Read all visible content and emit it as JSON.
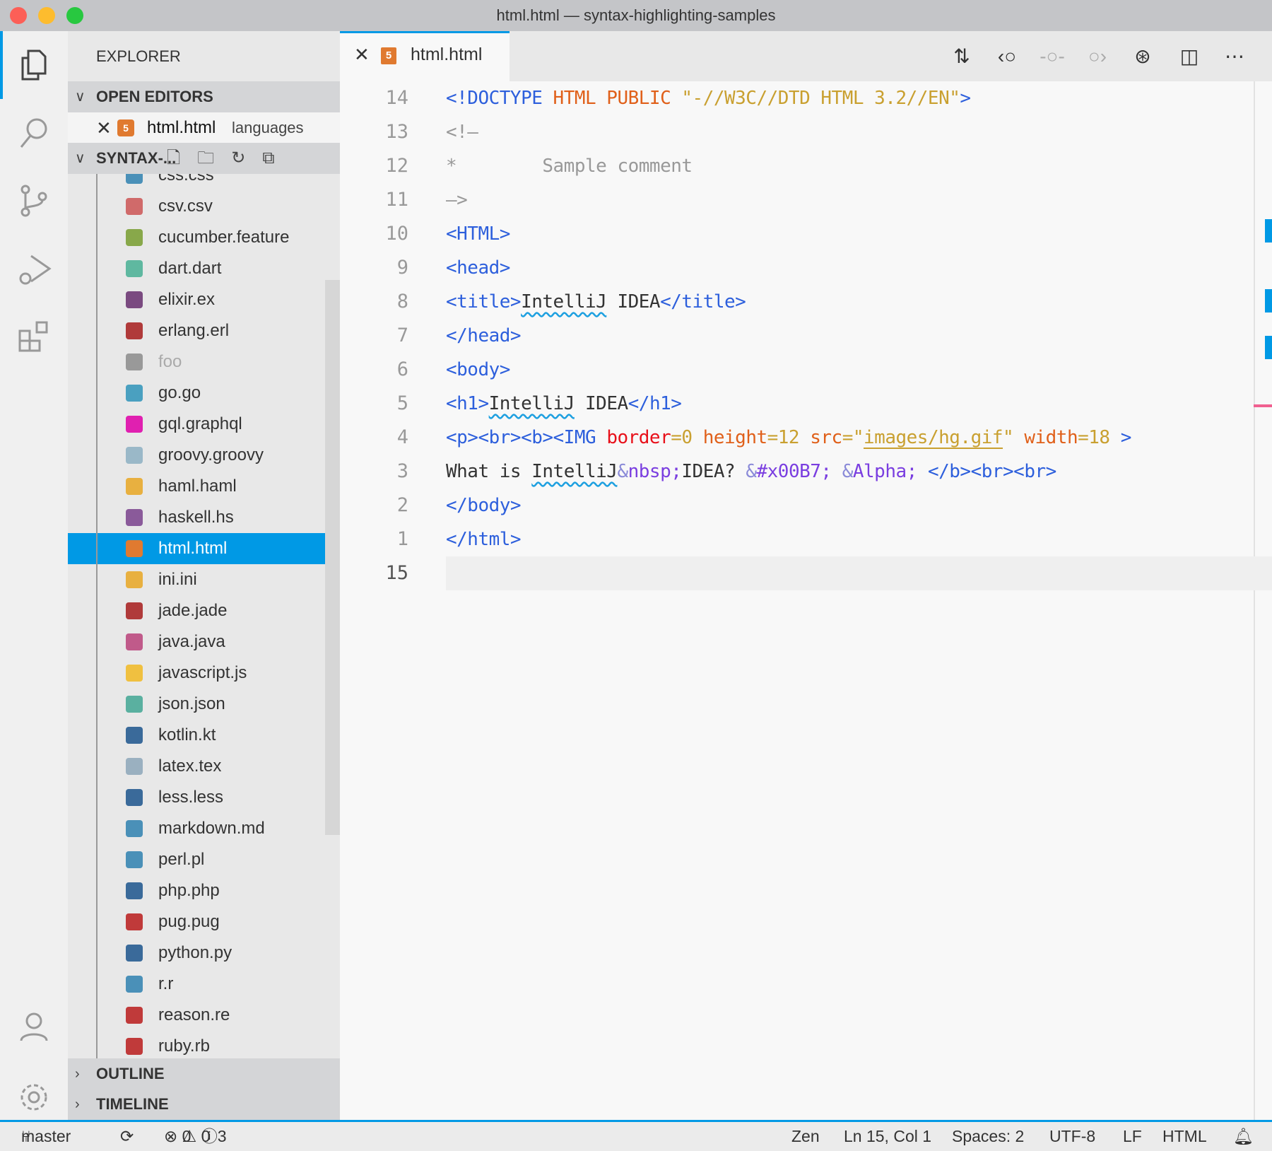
{
  "window": {
    "title": "html.html — syntax-highlighting-samples"
  },
  "colors": {
    "accent": "#0099e5",
    "tag": "#2d5fdc",
    "attr": "#e0601a",
    "attr_red": "#e8101a",
    "value": "#c9a030",
    "entity": "#7a3ee0",
    "entity_amp": "#8a8ad8",
    "text": "#333333",
    "comment": "#999999"
  },
  "activity": [
    "explorer-icon",
    "search-icon",
    "source-control-icon",
    "run-debug-icon",
    "extensions-icon",
    "account-icon",
    "settings-gear-icon"
  ],
  "sidebar": {
    "title": "EXPLORER",
    "open_editors": {
      "label": "OPEN EDITORS",
      "item": {
        "name": "html.html",
        "desc": "languages"
      }
    },
    "folder": {
      "label": "SYNTAX-..."
    },
    "files": [
      {
        "name": "css.css",
        "icon": "css-icon",
        "color": "#4a90b8"
      },
      {
        "name": "csv.csv",
        "icon": "csv-icon",
        "color": "#d06a6a"
      },
      {
        "name": "cucumber.feature",
        "icon": "cucumber-icon",
        "color": "#88a84a"
      },
      {
        "name": "dart.dart",
        "icon": "dart-icon",
        "color": "#5fb8a0"
      },
      {
        "name": "elixir.ex",
        "icon": "elixir-icon",
        "color": "#7a4a80"
      },
      {
        "name": "erlang.erl",
        "icon": "erlang-icon",
        "color": "#b03a3a"
      },
      {
        "name": "foo",
        "icon": "file-icon",
        "color": "#999999",
        "dim": true
      },
      {
        "name": "go.go",
        "icon": "go-icon",
        "color": "#4aa0c0"
      },
      {
        "name": "gql.graphql",
        "icon": "graphql-icon",
        "color": "#e020b0"
      },
      {
        "name": "groovy.groovy",
        "icon": "groovy-icon",
        "color": "#9ab8c8"
      },
      {
        "name": "haml.haml",
        "icon": "haml-icon",
        "color": "#e8b040"
      },
      {
        "name": "haskell.hs",
        "icon": "haskell-icon",
        "color": "#8a5a9a"
      },
      {
        "name": "html.html",
        "icon": "html-icon",
        "color": "#e07a30",
        "selected": true
      },
      {
        "name": "ini.ini",
        "icon": "ini-icon",
        "color": "#e8b040"
      },
      {
        "name": "jade.jade",
        "icon": "jade-icon",
        "color": "#b03a3a"
      },
      {
        "name": "java.java",
        "icon": "java-icon",
        "color": "#c05a8a"
      },
      {
        "name": "javascript.js",
        "icon": "javascript-icon",
        "color": "#f0c040"
      },
      {
        "name": "json.json",
        "icon": "json-icon",
        "color": "#5ab0a0"
      },
      {
        "name": "kotlin.kt",
        "icon": "kotlin-icon",
        "color": "#3a6a9a"
      },
      {
        "name": "latex.tex",
        "icon": "latex-icon",
        "color": "#9ab0c0"
      },
      {
        "name": "less.less",
        "icon": "less-icon",
        "color": "#3a6a9a"
      },
      {
        "name": "markdown.md",
        "icon": "markdown-icon",
        "color": "#4a90b8"
      },
      {
        "name": "perl.pl",
        "icon": "perl-icon",
        "color": "#4a90b8"
      },
      {
        "name": "php.php",
        "icon": "php-icon",
        "color": "#3a6a9a"
      },
      {
        "name": "pug.pug",
        "icon": "pug-icon",
        "color": "#c03a3a"
      },
      {
        "name": "python.py",
        "icon": "python-icon",
        "color": "#3a6a9a"
      },
      {
        "name": "r.r",
        "icon": "r-icon",
        "color": "#4a90b8"
      },
      {
        "name": "reason.re",
        "icon": "reason-icon",
        "color": "#c03a3a"
      },
      {
        "name": "ruby.rb",
        "icon": "ruby-icon",
        "color": "#c03a3a"
      }
    ],
    "outline": "OUTLINE",
    "timeline": "TIMELINE"
  },
  "tab": {
    "label": "html.html"
  },
  "toolbar": [
    "compare-changes-icon",
    "previous-change-icon",
    "commit-icon",
    "next-change-icon",
    "git-graph-icon",
    "split-editor-icon",
    "more-actions-icon"
  ],
  "code": [
    {
      "n": "14",
      "t": [
        [
          "<!DOCTYPE",
          "tag"
        ],
        [
          " HTML PUBLIC",
          "attr"
        ],
        [
          " \"-//W3C//DTD HTML 3.2//EN\"",
          "value"
        ],
        [
          ">",
          "tag"
        ]
      ]
    },
    {
      "n": "13",
      "t": [
        [
          "<!—",
          "comment"
        ]
      ]
    },
    {
      "n": "12",
      "t": [
        [
          "*        Sample comment",
          "comment"
        ]
      ]
    },
    {
      "n": "11",
      "t": [
        [
          "—>",
          "comment"
        ]
      ]
    },
    {
      "n": "10",
      "t": [
        [
          "<HTML>",
          "tag"
        ]
      ]
    },
    {
      "n": "9",
      "t": [
        [
          "<head>",
          "tag"
        ]
      ]
    },
    {
      "n": "8",
      "t": [
        [
          "<title>",
          "tag"
        ],
        [
          "IntelliJ",
          "text-sq"
        ],
        [
          " IDEA",
          "text"
        ],
        [
          "</title>",
          "tag"
        ]
      ]
    },
    {
      "n": "7",
      "t": [
        [
          "</head>",
          "tag"
        ]
      ]
    },
    {
      "n": "6",
      "t": [
        [
          "<body>",
          "tag"
        ]
      ]
    },
    {
      "n": "5",
      "t": [
        [
          "<h1>",
          "tag"
        ],
        [
          "IntelliJ",
          "text-sq"
        ],
        [
          " IDEA",
          "text"
        ],
        [
          "</h1>",
          "tag"
        ]
      ]
    },
    {
      "n": "4",
      "t": [
        [
          "<p><br><b><IMG ",
          "tag"
        ],
        [
          "border",
          "attr_red"
        ],
        [
          "=0 ",
          "value"
        ],
        [
          "height",
          "attr"
        ],
        [
          "=12 ",
          "value"
        ],
        [
          "src",
          "attr"
        ],
        [
          "=\"",
          "value"
        ],
        [
          "images/hg.gif",
          "value-ul"
        ],
        [
          "\"",
          "value"
        ],
        [
          " width",
          "attr"
        ],
        [
          "=18",
          "value"
        ],
        [
          " >",
          "tag"
        ]
      ]
    },
    {
      "n": "3",
      "t": [
        [
          "What is ",
          "text"
        ],
        [
          "IntelliJ",
          "text-sq"
        ],
        [
          "&",
          "entity_amp"
        ],
        [
          "nbsp;",
          "entity"
        ],
        [
          "IDEA? ",
          "text"
        ],
        [
          "&",
          "entity_amp"
        ],
        [
          "#x00B7; ",
          "entity"
        ],
        [
          "&",
          "entity_amp"
        ],
        [
          "Alpha; ",
          "entity"
        ],
        [
          "</b><br><br>",
          "tag"
        ]
      ]
    },
    {
      "n": "2",
      "t": [
        [
          "</body>",
          "tag"
        ]
      ]
    },
    {
      "n": "1",
      "t": [
        [
          "</html>",
          "tag"
        ]
      ]
    },
    {
      "n": "15",
      "t": [],
      "current": true
    }
  ],
  "status": {
    "branch": "master",
    "errors": "0",
    "warnings": "0",
    "infos": "3",
    "zen": "Zen",
    "position": "Ln 15, Col 1",
    "spaces": "Spaces: 2",
    "encoding": "UTF-8",
    "eol": "LF",
    "language": "HTML"
  }
}
